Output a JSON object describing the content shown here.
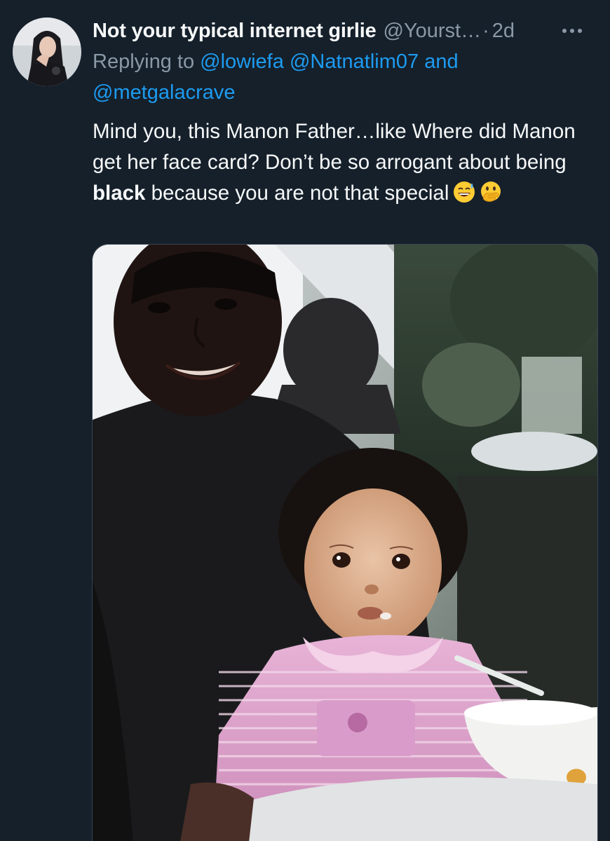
{
  "tweet": {
    "display_name": "Not your typical internet girlie",
    "handle": "@Yourst…",
    "separator": "·",
    "timestamp": "2d",
    "replying_prefix": "Replying to",
    "mentions": [
      "@lowiefa",
      "@Natnatlim07",
      "@metgalacrave"
    ],
    "mention_joiner": "and",
    "text_part1": "Mind you, this Manon Father…like Where did Manon get her face card? Don’t be so arrogant about being ",
    "text_bold": "black",
    "text_part2": " because you are not that special",
    "emojis": [
      "grinning-face-with-sweat",
      "face-with-open-eyes-and-hand-over-mouth"
    ]
  },
  "colors": {
    "background": "#15202b",
    "text_primary": "#f7f9f9",
    "text_secondary": "#8b98a5",
    "link": "#1d9bf0"
  },
  "icons": {
    "more": "more-horizontal-icon"
  }
}
